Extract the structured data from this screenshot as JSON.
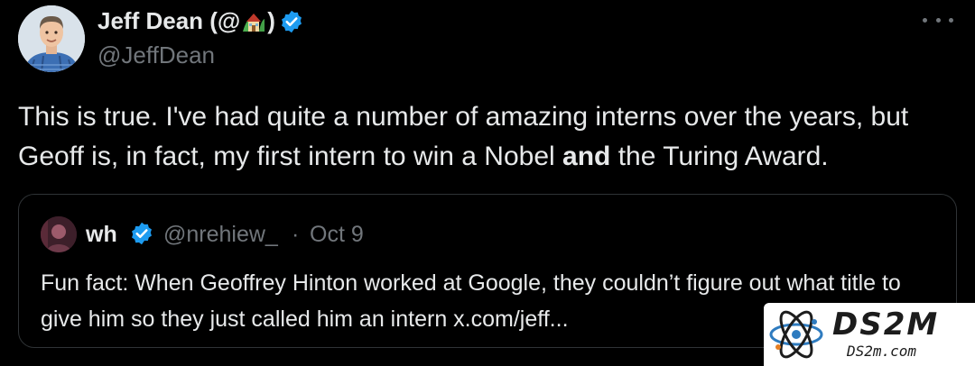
{
  "author": {
    "name_prefix": "Jeff Dean (@",
    "name_suffix": ")",
    "handle": "@JeffDean"
  },
  "tweet": {
    "text_part1": "This is true. I've had quite a number of amazing interns over the years, but Geoff is, in fact, my first intern to win a Nobel ",
    "text_bold": "and",
    "text_part2": " the Turing Award."
  },
  "quoted": {
    "name": "wh",
    "handle": "@nrehiew_",
    "separator": "·",
    "date": "Oct 9",
    "text": "Fun fact: When Geoffrey Hinton worked at Google, they couldn’t figure out what title to give him so they just called him an intern x.com/jeff..."
  },
  "watermark": {
    "title": "DS2M",
    "subtitle": "DS2m.com"
  },
  "icons": {
    "verified": "verified-badge-icon",
    "more": "more-dots-icon",
    "house": "house-emoji-icon"
  },
  "colors": {
    "background": "#000000",
    "text": "#e7e9ea",
    "muted": "#71767b",
    "border": "#2f3336",
    "verified_blue": "#1d9bf0"
  }
}
